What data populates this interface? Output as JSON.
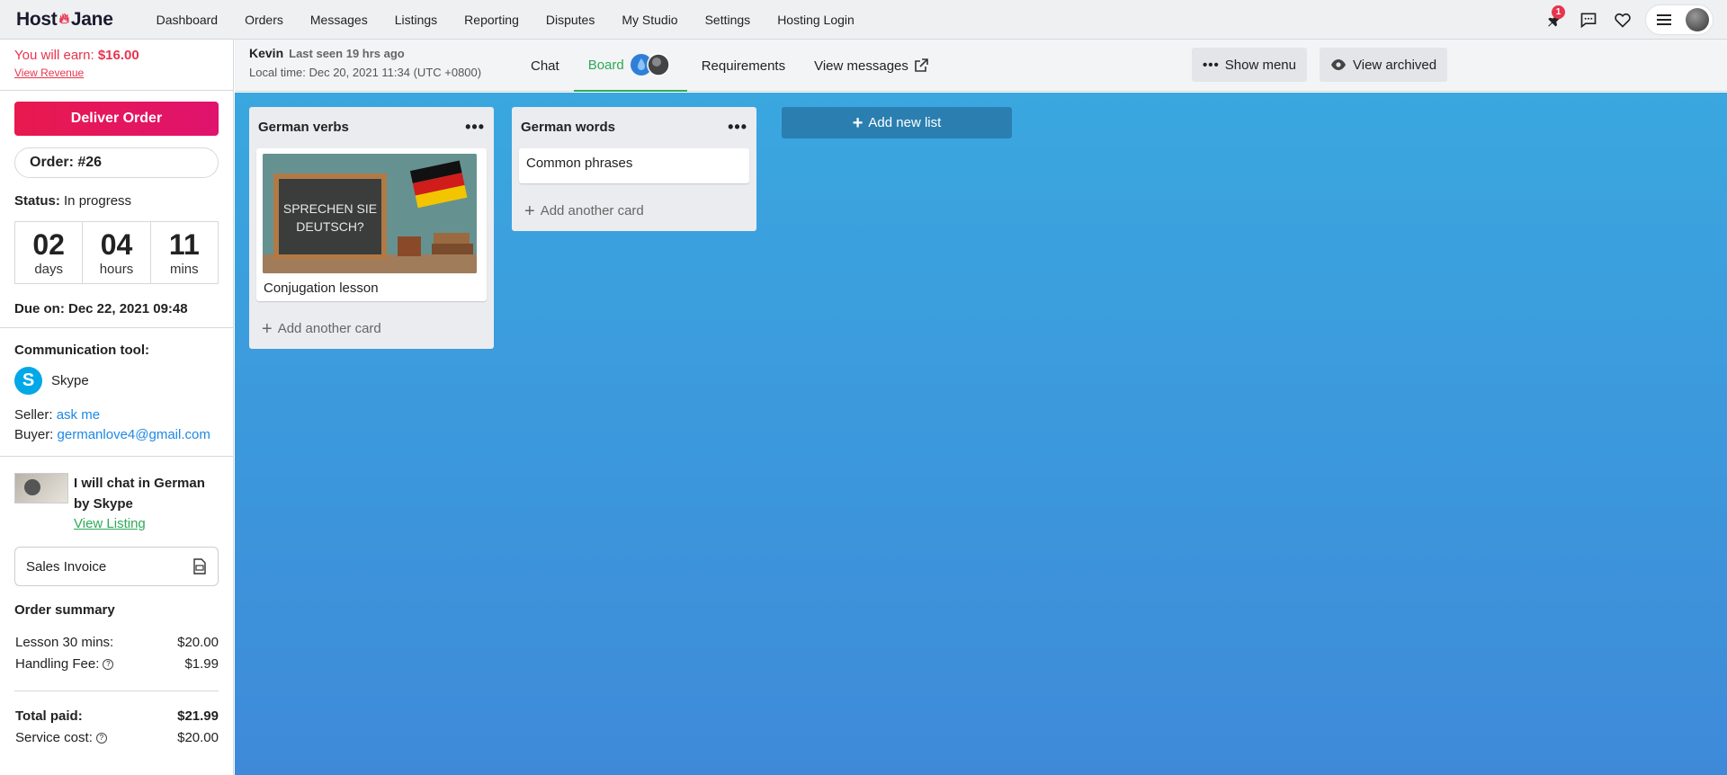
{
  "brand": {
    "host": "Host",
    "jane": "Jane"
  },
  "nav": [
    "Dashboard",
    "Orders",
    "Messages",
    "Listings",
    "Reporting",
    "Disputes",
    "My Studio",
    "Settings",
    "Hosting Login"
  ],
  "notifications": {
    "count": "1"
  },
  "sidebar": {
    "earn_label": "You will earn:",
    "earn_value": "$16.00",
    "view_revenue": "View Revenue",
    "deliver": "Deliver Order",
    "order": "Order: #26",
    "status_label": "Status:",
    "status_value": "In progress",
    "countdown": {
      "days": "02",
      "days_label": "days",
      "hours": "04",
      "hours_label": "hours",
      "mins": "11",
      "mins_label": "mins"
    },
    "due": "Due on: Dec 22, 2021 09:48",
    "comm_title": "Communication tool:",
    "comm_tool": "Skype",
    "seller_label": "Seller:",
    "seller_value": "ask me",
    "buyer_label": "Buyer:",
    "buyer_value": "germanlove4@gmail.com",
    "listing_title": "I will chat in German by Skype",
    "view_listing": "View Listing",
    "invoice": "Sales Invoice",
    "summary_title": "Order summary",
    "summary": [
      {
        "label": "Lesson 30 mins:",
        "value": "$20.00"
      },
      {
        "label": "Handling Fee:",
        "value": "$1.99"
      }
    ],
    "total_label": "Total paid:",
    "total_value": "$21.99",
    "service_label": "Service cost:",
    "service_value": "$20.00"
  },
  "header": {
    "name": "Kevin",
    "last_seen": "Last seen 19 hrs ago",
    "local_time": "Local time:  Dec 20, 2021 11:34 (UTC +0800)",
    "tabs": [
      "Chat",
      "Board",
      "Requirements",
      "View messages"
    ],
    "show_menu": "Show menu",
    "view_archived": "View archived"
  },
  "board": {
    "lists": [
      {
        "title": "German verbs",
        "cards": [
          {
            "title": "Conjugation lesson",
            "image_text": "SPRECHEN SIE DEUTSCH?"
          }
        ],
        "add": "Add another card"
      },
      {
        "title": "German words",
        "cards": [
          {
            "title": "Common phrases"
          }
        ],
        "add": "Add another card"
      }
    ],
    "add_list": "Add new list"
  },
  "colors": {
    "accent": "#e8344e",
    "green": "#2eaa57",
    "board_top": "#3aa7df",
    "board_bottom": "#3e8ad9",
    "link": "#1e88e5"
  }
}
